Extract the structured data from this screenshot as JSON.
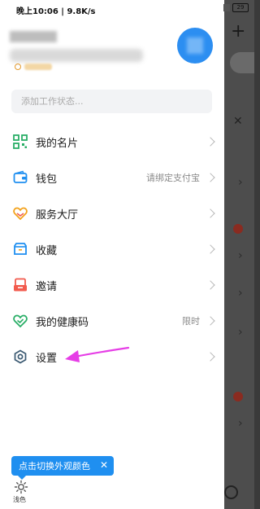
{
  "statusbar": {
    "time": "晚上10:06 | 9.8K/s",
    "battery": "29"
  },
  "search": {
    "placeholder": "添加工作状态..."
  },
  "menu": [
    {
      "label": "我的名片",
      "icon": "qr-card-icon",
      "color": "#2aae67"
    },
    {
      "label": "钱包",
      "icon": "wallet-icon",
      "color": "#1f8ff0",
      "hint": "请绑定支付宝"
    },
    {
      "label": "服务大厅",
      "icon": "heart-hands-icon",
      "color": "#f3a21b"
    },
    {
      "label": "收藏",
      "icon": "star-box-icon",
      "color": "#1f8ff0"
    },
    {
      "label": "邀请",
      "icon": "invite-icon",
      "color": "#f25a4d"
    },
    {
      "label": "我的健康码",
      "icon": "health-heart-icon",
      "color": "#2aae67",
      "hint": "限时"
    },
    {
      "label": "设置",
      "icon": "gear-icon",
      "color": "#3b5a72"
    }
  ],
  "tooltip": {
    "text": "点击切换外观颜色",
    "close": "✕"
  },
  "theme": {
    "label": "浅色",
    "icon": "sun-icon"
  },
  "colors": {
    "accent": "#1f8ff0",
    "pointer_arrow": "#e63ee6"
  }
}
